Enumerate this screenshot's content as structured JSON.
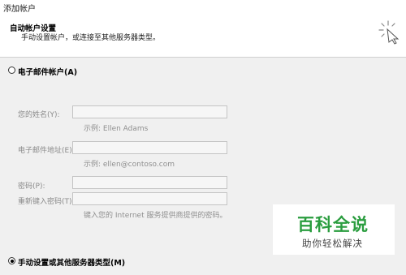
{
  "window": {
    "title": "添加帐户"
  },
  "header": {
    "title": "自动帐户设置",
    "description": "手动设置帐户，或连接至其他服务器类型。"
  },
  "options": {
    "email_account": {
      "label": "电子邮件帐户(A)",
      "selected": false
    },
    "manual_setup": {
      "label": "手动设置或其他服务器类型(M)",
      "selected": true
    }
  },
  "form": {
    "name": {
      "label": "您的姓名(Y):",
      "value": "",
      "hint": "示例: Ellen Adams"
    },
    "email": {
      "label": "电子邮件地址(E):",
      "value": "",
      "hint": "示例: ellen@contoso.com"
    },
    "password": {
      "label": "密码(P):",
      "value": ""
    },
    "password_confirm": {
      "label": "重新键入密码(T):",
      "value": ""
    },
    "password_hint": "键入您的 Internet 服务提供商提供的密码。"
  },
  "watermark": {
    "title": "百科全说",
    "subtitle": "助你轻松解决"
  },
  "colors": {
    "background": "#f0f0f0",
    "watermark_green": "#2a9d3f"
  }
}
